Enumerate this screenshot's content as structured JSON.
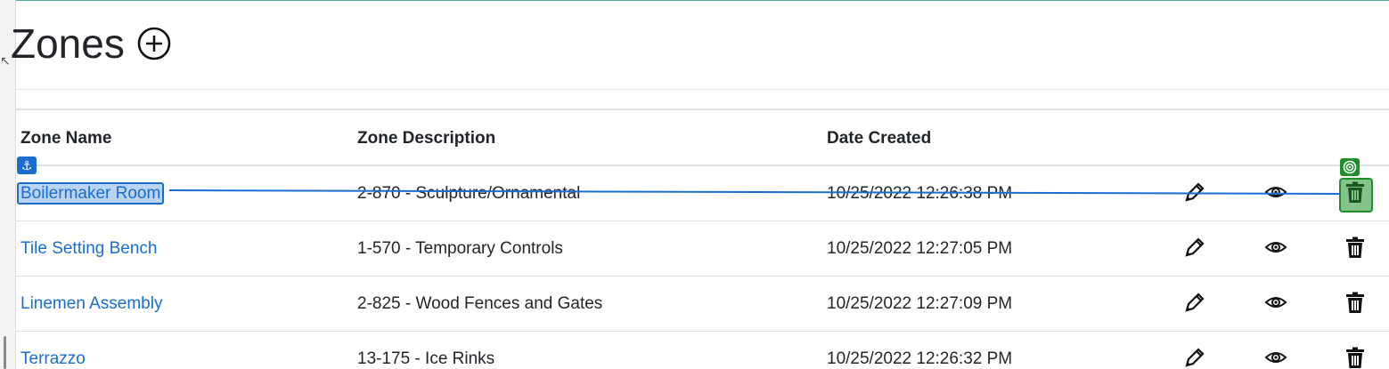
{
  "page": {
    "title": "Zones",
    "add_icon": "circle-plus-icon"
  },
  "table": {
    "headers": {
      "name": "Zone Name",
      "description": "Zone Description",
      "date": "Date Created"
    },
    "rows": [
      {
        "name": "Boilermaker Room",
        "description": "2-870 - Sculpture/Ornamental",
        "date": "10/25/2022 12:26:38 PM",
        "selected": true
      },
      {
        "name": "Tile Setting Bench",
        "description": "1-570 - Temporary Controls",
        "date": "10/25/2022 12:27:05 PM"
      },
      {
        "name": "Linemen Assembly",
        "description": "2-825 - Wood Fences and Gates",
        "date": "10/25/2022 12:27:09 PM"
      },
      {
        "name": "Terrazzo",
        "description": "13-175 - Ice Rinks",
        "date": "10/25/2022 12:26:32 PM"
      }
    ],
    "row_actions": [
      "pencil-icon",
      "eye-icon",
      "trash-icon"
    ]
  },
  "overlay": {
    "source_badge_icon": "anchor-icon",
    "target_badge_icon": "target-icon",
    "source_color": "#1a6dcf",
    "target_color": "#1f8f2b"
  }
}
